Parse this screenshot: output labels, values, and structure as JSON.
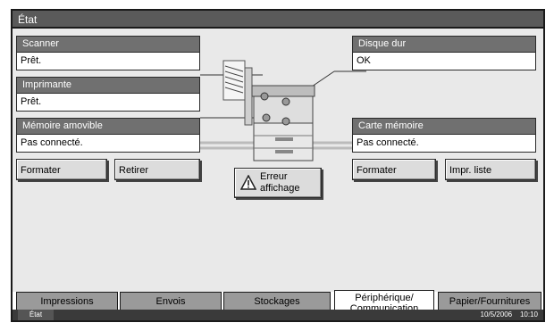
{
  "title": "État",
  "scanner": {
    "label": "Scanner",
    "value": "Prêt."
  },
  "printer": {
    "label": "Imprimante",
    "value": "Prêt."
  },
  "removable": {
    "label": "Mémoire amovible",
    "value": "Pas connecté."
  },
  "hdd": {
    "label": "Disque dur",
    "value": "OK"
  },
  "memcard": {
    "label": "Carte mémoire",
    "value": "Pas connecté."
  },
  "buttons": {
    "format_left": "Formater",
    "remove": "Retirer",
    "error_line1": "Erreur",
    "error_line2": "affichage",
    "format_right": "Formater",
    "print_list": "Impr. liste"
  },
  "tabs": [
    {
      "label": "Impressions"
    },
    {
      "label": "Envois"
    },
    {
      "label": "Stockages"
    },
    {
      "label": "Périphérique/ Communication"
    },
    {
      "label": "Papier/Fournitures"
    }
  ],
  "status": {
    "label": "État",
    "datetime": "10/5/2006    10:10"
  },
  "icons": {
    "warning": "warning-icon",
    "device": "printer-device-illustration"
  },
  "colors": {
    "title_bar": "#5a5a5a",
    "panel_head": "#707070",
    "tab": "#9a9a9a",
    "background": "#e9e9e9"
  }
}
